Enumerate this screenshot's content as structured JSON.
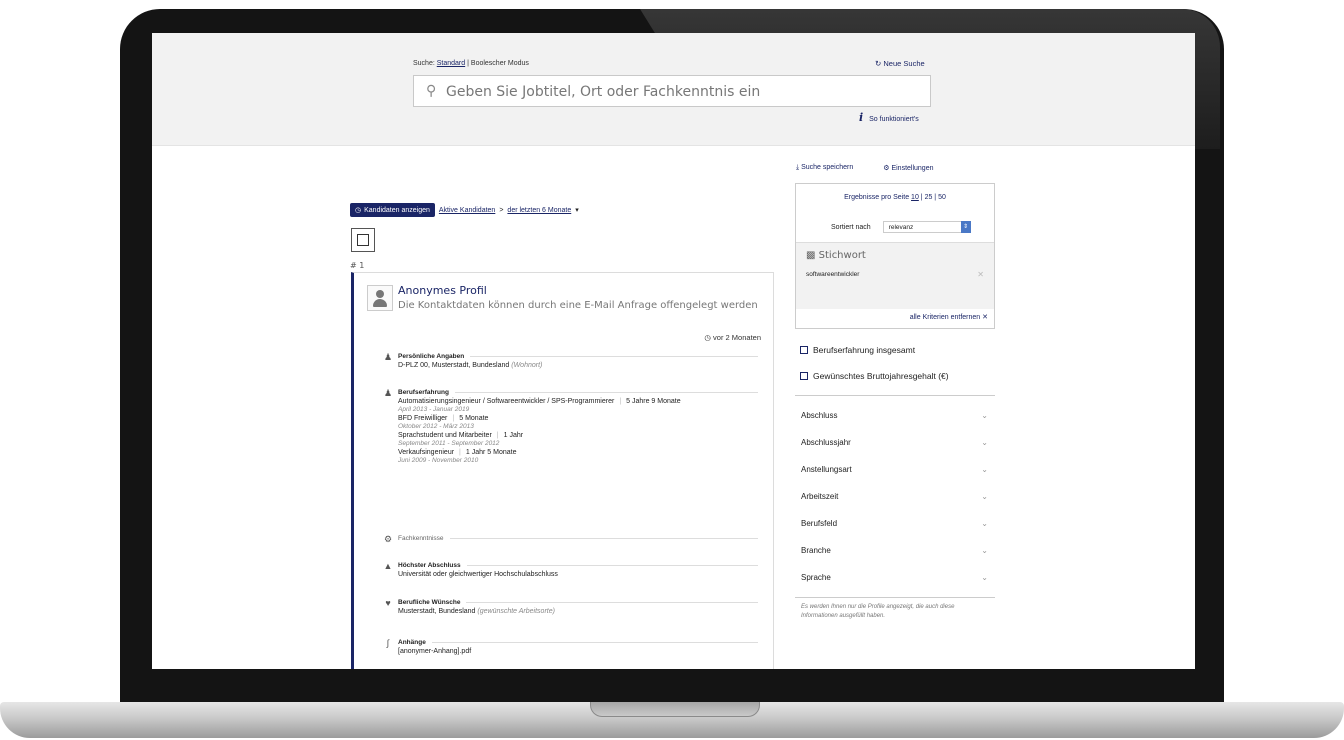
{
  "search": {
    "mode_prefix": "Suche:",
    "mode_standard": "Standard",
    "mode_sep": "|",
    "mode_boolean": "Boolescher Modus",
    "new_search": "Neue Suche",
    "placeholder": "Geben Sie Jobtitel, Ort oder Fachkenntnis ein",
    "howto": "So funktioniert's"
  },
  "filter": {
    "show_button": "Kandidaten anzeigen",
    "active": "Aktive Kandidaten",
    "arrow": ">",
    "period": "der letzten 6 Monate"
  },
  "result": {
    "rank": "# 1",
    "title": "Anonymes Profil",
    "subtitle": "Die Kontaktdaten können durch eine E-Mail Anfrage offengelegt werden",
    "time": "vor 2 Monaten",
    "personal_head": "Persönliche Angaben",
    "personal_value": "D-PLZ 00, Musterstadt, Bundesland",
    "personal_note": "(Wohnort)",
    "experience_head": "Berufserfahrung",
    "experience": [
      {
        "title": "Automatisierungsingenieur / Softwareentwickler / SPS-Programmierer",
        "duration": "5 Jahre 9 Monate",
        "dates": "April 2013 - Januar 2019"
      },
      {
        "title": "BFD Freiwilliger",
        "duration": "5 Monate",
        "dates": "Oktober 2012 - März 2013"
      },
      {
        "title": "Sprachstudent und Mitarbeiter",
        "duration": "1 Jahr",
        "dates": "September 2011 - September 2012"
      },
      {
        "title": "Verkaufsingenieur",
        "duration": "1 Jahr 5 Monate",
        "dates": "Juni 2009 - November 2010"
      }
    ],
    "skills_head": "Fachkenntnisse",
    "degree_head": "Höchster Abschluss",
    "degree_value": "Universität oder gleichwertiger Hochschulabschluss",
    "wishes_head": "Berufliche Wünsche",
    "wishes_value": "Musterstadt, Bundesland",
    "wishes_note": "(gewünschte Arbeitsorte)",
    "attachments_head": "Anhänge",
    "attachments_value": "[anonymer-Anhang].pdf"
  },
  "sidebar": {
    "save_search": "Suche speichern",
    "settings": "Einstellungen",
    "per_page_label": "Ergebnisse pro Seite",
    "per_page_10": "10",
    "per_page_25": "25",
    "per_page_50": "50",
    "sort_label": "Sortiert nach",
    "sort_value": "relevanz",
    "keyword_title": "Stichwort",
    "keyword_value": "softwareentwickler",
    "clear_all": "alle Kriterien entfernen",
    "check_experience": "Berufserfahrung insgesamt",
    "check_salary": "Gewünschtes Bruttojahresgehalt (€)",
    "accordion": [
      "Abschluss",
      "Abschlussjahr",
      "Anstellungsart",
      "Arbeitszeit",
      "Berufsfeld",
      "Branche",
      "Sprache"
    ],
    "footnote": "Es werden Ihnen nur die Profile angezeigt, die auch diese Informationen ausgefüllt haben."
  },
  "colors": {
    "accent": "#1a2566",
    "band": "#f2f2f2"
  }
}
